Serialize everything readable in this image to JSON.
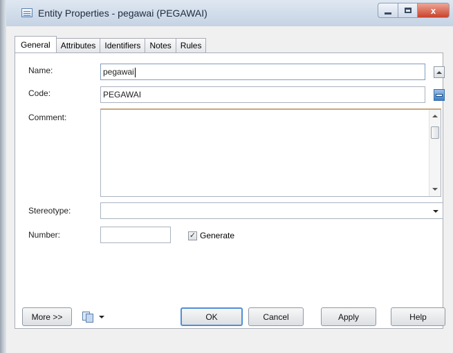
{
  "window": {
    "title": "Entity Properties - pegawai (PEGAWAI)",
    "close_glyph": "x"
  },
  "tabs": [
    {
      "label": "General",
      "active": true
    },
    {
      "label": "Attributes",
      "active": false
    },
    {
      "label": "Identifiers",
      "active": false
    },
    {
      "label": "Notes",
      "active": false
    },
    {
      "label": "Rules",
      "active": false
    }
  ],
  "form": {
    "name_label": "Name:",
    "name_value": "pegawai",
    "code_label": "Code:",
    "code_value": "PEGAWAI",
    "comment_label": "Comment:",
    "comment_value": "",
    "stereotype_label": "Stereotype:",
    "stereotype_value": "",
    "number_label": "Number:",
    "number_value": "",
    "generate_label": "Generate",
    "generate_checked": true,
    "check_glyph": "✓"
  },
  "buttons": {
    "more": "More >>",
    "ok": "OK",
    "cancel": "Cancel",
    "apply": "Apply",
    "help": "Help"
  },
  "icons": {
    "title": "entity-window-icon",
    "toolbar": "print-pages-icon"
  },
  "colors": {
    "titlebar": "#c5d3e4",
    "close_button": "#c9432b",
    "ok_border": "#4f8ed8",
    "code_button": "#3d7ec9"
  }
}
